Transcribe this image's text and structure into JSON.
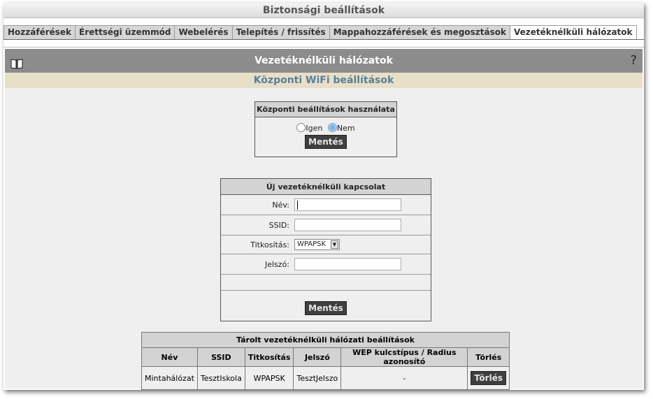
{
  "window": {
    "title": "Biztonsági beállítások"
  },
  "tabs": [
    {
      "label": "Hozzáférések"
    },
    {
      "label": "Érettségi üzemmód"
    },
    {
      "label": "Webelérés"
    },
    {
      "label": "Telepítés / frissítés"
    },
    {
      "label": "Mappahozzáférések és megosztások"
    },
    {
      "label": "Vezetéknélküli hálózatok",
      "active": true
    }
  ],
  "header": {
    "title": "Vezetéknélküli hálózatok",
    "help_glyph": "?",
    "book_icon": "book-icon",
    "help_icon": "help-icon"
  },
  "subheader": {
    "title": "Központi WiFi beállítások"
  },
  "central": {
    "title": "Központi beállítások használata",
    "option_yes": "Igen",
    "option_no": "Nem",
    "selected": "Nem",
    "save": "Mentés"
  },
  "new_connection": {
    "title": "Új vezetéknélküli kapcsolat",
    "name_label": "Név:",
    "name_value": "",
    "ssid_label": "SSID:",
    "ssid_value": "",
    "encryption_label": "Titkosítás:",
    "encryption_value": "WPAPSK",
    "password_label": "Jelszó:",
    "password_value": "",
    "save": "Mentés"
  },
  "stored": {
    "title": "Tárolt vezetéknélküli hálózati beállítások",
    "columns": [
      "Név",
      "SSID",
      "Titkosítás",
      "Jelszó",
      "WEP kulcstípus / Radius azonosító",
      "Törlés"
    ],
    "rows": [
      {
        "name": "Mintahálózat",
        "ssid": "TesztIskola",
        "encryption": "WPAPSK",
        "password": "TesztJelszo",
        "wep": "-",
        "delete": "Törlés"
      }
    ]
  }
}
